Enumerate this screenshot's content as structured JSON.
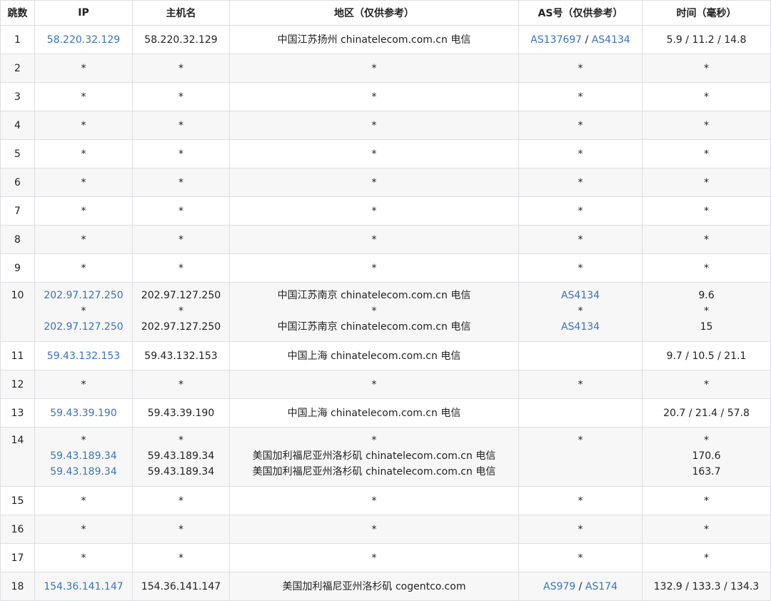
{
  "headers": [
    "跳数",
    "IP",
    "主机名",
    "地区（仅供参考）",
    "AS号（仅供参考）",
    "时间（毫秒）"
  ],
  "rows": [
    {
      "hop": "1",
      "lines": [
        {
          "ip": "58.220.32.129",
          "host": "58.220.32.129",
          "region": "中国江苏扬州 chinatelecom.com.cn 电信"
        }
      ],
      "as": [
        "AS137697",
        "AS4134"
      ],
      "time": [
        "5.9 / 11.2 / 14.8"
      ]
    },
    {
      "hop": "2",
      "lines": [
        {
          "ip": "*",
          "host": "*",
          "region": "*"
        }
      ],
      "as": [
        "*"
      ],
      "time": [
        "*"
      ]
    },
    {
      "hop": "3",
      "lines": [
        {
          "ip": "*",
          "host": "*",
          "region": "*"
        }
      ],
      "as": [
        "*"
      ],
      "time": [
        "*"
      ]
    },
    {
      "hop": "4",
      "lines": [
        {
          "ip": "*",
          "host": "*",
          "region": "*"
        }
      ],
      "as": [
        "*"
      ],
      "time": [
        "*"
      ]
    },
    {
      "hop": "5",
      "lines": [
        {
          "ip": "*",
          "host": "*",
          "region": "*"
        }
      ],
      "as": [
        "*"
      ],
      "time": [
        "*"
      ]
    },
    {
      "hop": "6",
      "lines": [
        {
          "ip": "*",
          "host": "*",
          "region": "*"
        }
      ],
      "as": [
        "*"
      ],
      "time": [
        "*"
      ]
    },
    {
      "hop": "7",
      "lines": [
        {
          "ip": "*",
          "host": "*",
          "region": "*"
        }
      ],
      "as": [
        "*"
      ],
      "time": [
        "*"
      ]
    },
    {
      "hop": "8",
      "lines": [
        {
          "ip": "*",
          "host": "*",
          "region": "*"
        }
      ],
      "as": [
        "*"
      ],
      "time": [
        "*"
      ]
    },
    {
      "hop": "9",
      "lines": [
        {
          "ip": "*",
          "host": "*",
          "region": "*"
        }
      ],
      "as": [
        "*"
      ],
      "time": [
        "*"
      ]
    },
    {
      "hop": "10",
      "lines": [
        {
          "ip": "202.97.127.250",
          "host": "202.97.127.250",
          "region": "中国江苏南京 chinatelecom.com.cn 电信",
          "as": "AS4134",
          "time": "9.6"
        },
        {
          "ip": "*",
          "host": "*",
          "region": "*",
          "as": "*",
          "time": "*"
        },
        {
          "ip": "202.97.127.250",
          "host": "202.97.127.250",
          "region": "中国江苏南京 chinatelecom.com.cn 电信",
          "as": "AS4134",
          "time": "15"
        }
      ]
    },
    {
      "hop": "11",
      "lines": [
        {
          "ip": "59.43.132.153",
          "host": "59.43.132.153",
          "region": "中国上海 chinatelecom.com.cn 电信"
        }
      ],
      "as": [],
      "time": [
        "9.7 / 10.5 / 21.1"
      ]
    },
    {
      "hop": "12",
      "lines": [
        {
          "ip": "*",
          "host": "*",
          "region": "*"
        }
      ],
      "as": [
        "*"
      ],
      "time": [
        "*"
      ]
    },
    {
      "hop": "13",
      "lines": [
        {
          "ip": "59.43.39.190",
          "host": "59.43.39.190",
          "region": "中国上海 chinatelecom.com.cn 电信"
        }
      ],
      "as": [],
      "time": [
        "20.7 / 21.4 / 57.8"
      ]
    },
    {
      "hop": "14",
      "lines": [
        {
          "ip": "*",
          "host": "*",
          "region": "*",
          "as": "*",
          "time": "*"
        },
        {
          "ip": "59.43.189.34",
          "host": "59.43.189.34",
          "region": "美国加利福尼亚州洛杉矶 chinatelecom.com.cn 电信",
          "as": "",
          "time": "170.6"
        },
        {
          "ip": "59.43.189.34",
          "host": "59.43.189.34",
          "region": "美国加利福尼亚州洛杉矶 chinatelecom.com.cn 电信",
          "as": "",
          "time": "163.7"
        }
      ]
    },
    {
      "hop": "15",
      "lines": [
        {
          "ip": "*",
          "host": "*",
          "region": "*"
        }
      ],
      "as": [
        "*"
      ],
      "time": [
        "*"
      ]
    },
    {
      "hop": "16",
      "lines": [
        {
          "ip": "*",
          "host": "*",
          "region": "*"
        }
      ],
      "as": [
        "*"
      ],
      "time": [
        "*"
      ]
    },
    {
      "hop": "17",
      "lines": [
        {
          "ip": "*",
          "host": "*",
          "region": "*"
        }
      ],
      "as": [
        "*"
      ],
      "time": [
        "*"
      ]
    },
    {
      "hop": "18",
      "lines": [
        {
          "ip": "154.36.141.147",
          "host": "154.36.141.147",
          "region": "美国加利福尼亚州洛杉矶 cogentco.com"
        }
      ],
      "as": [
        "AS979",
        "AS174"
      ],
      "time": [
        "132.9 / 133.3 / 134.3"
      ]
    }
  ],
  "colors": {
    "link": "#3b73b9",
    "border": "#dcdfe3",
    "stripe": "#f7f7f7"
  }
}
